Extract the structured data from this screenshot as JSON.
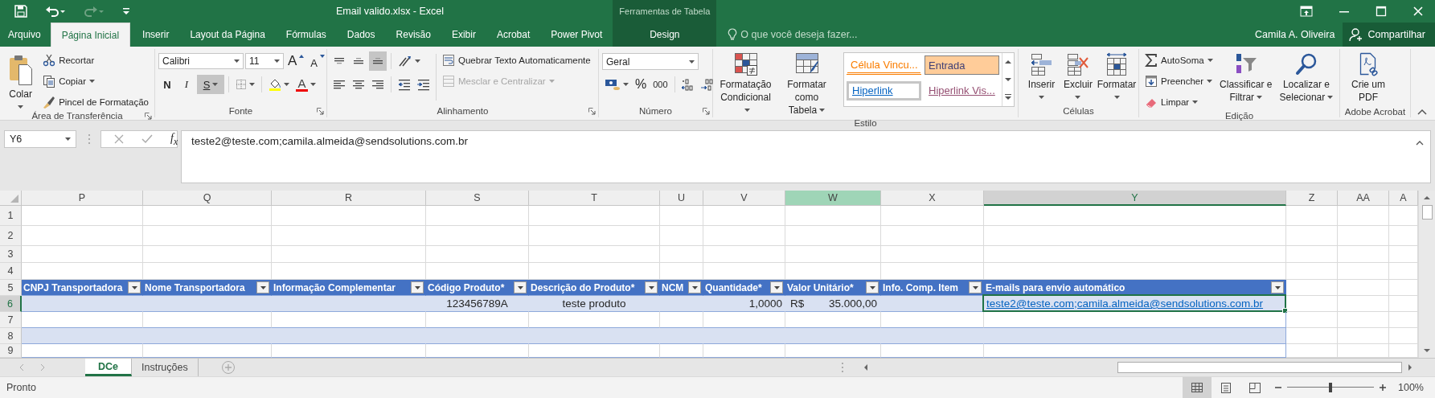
{
  "window": {
    "title": "Email valido.xlsx - Excel"
  },
  "contextual_tab_group": {
    "label": "Ferramentas de Tabela"
  },
  "tabs": [
    {
      "label": "Arquivo",
      "selected": false,
      "kind": "file"
    },
    {
      "label": "Página Inicial",
      "selected": true,
      "kind": "normal"
    },
    {
      "label": "Inserir",
      "selected": false,
      "kind": "normal"
    },
    {
      "label": "Layout da Página",
      "selected": false,
      "kind": "normal"
    },
    {
      "label": "Fórmulas",
      "selected": false,
      "kind": "normal"
    },
    {
      "label": "Dados",
      "selected": false,
      "kind": "normal"
    },
    {
      "label": "Revisão",
      "selected": false,
      "kind": "normal"
    },
    {
      "label": "Exibir",
      "selected": false,
      "kind": "normal"
    },
    {
      "label": "Acrobat",
      "selected": false,
      "kind": "normal"
    },
    {
      "label": "Power Pivot",
      "selected": false,
      "kind": "normal"
    },
    {
      "label": "Design",
      "selected": false,
      "kind": "contextual"
    }
  ],
  "tell_me": {
    "placeholder": "O que você deseja fazer..."
  },
  "account": {
    "user": "Camila A. Oliveira",
    "share": "Compartilhar"
  },
  "ribbon": {
    "groups": [
      {
        "kind": "clipboard",
        "label": "Área de Transferência",
        "launcher": true,
        "buttons": [
          {
            "label": "Colar"
          },
          {
            "label": "Recortar"
          },
          {
            "label": "Copiar"
          },
          {
            "label": "Pincel de Formatação"
          }
        ]
      },
      {
        "kind": "font",
        "label": "Fonte",
        "launcher": true,
        "font_name": "Calibri",
        "font_size": "11",
        "grow": "A",
        "shrink": "A",
        "styles": [
          {
            "label": "N",
            "pressed": false
          },
          {
            "label": "I",
            "pressed": false
          },
          {
            "label": "S",
            "pressed": true
          }
        ],
        "font_color": "A"
      },
      {
        "kind": "alignment",
        "label": "Alinhamento",
        "launcher": true,
        "vertical": [
          {
            "selected": false
          },
          {
            "selected": false
          },
          {
            "selected": true
          }
        ],
        "horizontal": [
          {
            "selected": false
          },
          {
            "selected": false
          },
          {
            "selected": false
          }
        ],
        "wrap_text": {
          "label": "Quebrar Texto Automaticamente",
          "disabled": false
        },
        "merge": {
          "label": "Mesclar e Centralizar",
          "disabled": true
        }
      },
      {
        "kind": "number",
        "label": "Número",
        "launcher": true,
        "format": "Geral",
        "percent": "%",
        "thousands": "000"
      },
      {
        "kind": "styles",
        "label": "Estilo",
        "buttons": [
          {
            "label": "Formatação Condicional"
          },
          {
            "label": "Formatar como Tabela"
          }
        ],
        "gallery": [
          {
            "label": "Célula Vincu...",
            "kind": "linked",
            "selected": false
          },
          {
            "label": "Entrada",
            "kind": "input",
            "selected": false
          },
          {
            "label": "Hiperlink",
            "kind": "hyperlink",
            "selected": true
          },
          {
            "label": "Hiperlink Vis...",
            "kind": "followed",
            "selected": false
          }
        ]
      },
      {
        "kind": "cells",
        "label": "Células",
        "buttons": [
          {
            "label": "Inserir"
          },
          {
            "label": "Excluir"
          },
          {
            "label": "Formatar"
          }
        ]
      },
      {
        "kind": "editing",
        "label": "Edição",
        "buttons": [
          {
            "label": "AutoSoma"
          },
          {
            "label": "Preencher"
          },
          {
            "label": "Limpar"
          },
          {
            "label": "Classificar e Filtrar"
          },
          {
            "label": "Localizar e Selecionar"
          }
        ]
      },
      {
        "kind": "acrobat",
        "label": "Adobe Acrobat",
        "buttons": [
          {
            "label": "Crie um PDF"
          }
        ]
      }
    ]
  },
  "formula_bar": {
    "name_box": "Y6",
    "function_label": "f$_{x}$",
    "value": "teste2@teste.com;camila.almeida@sendsolutions.com.br"
  },
  "sheet": {
    "columns": [
      {
        "label": "P",
        "selected": false,
        "highlighted": false
      },
      {
        "label": "Q",
        "selected": false,
        "highlighted": false
      },
      {
        "label": "R",
        "selected": false,
        "highlighted": false
      },
      {
        "label": "S",
        "selected": false,
        "highlighted": false
      },
      {
        "label": "T",
        "selected": false,
        "highlighted": false
      },
      {
        "label": "U",
        "selected": false,
        "highlighted": false
      },
      {
        "label": "V",
        "selected": false,
        "highlighted": false
      },
      {
        "label": "W",
        "selected": false,
        "highlighted": true
      },
      {
        "label": "X",
        "selected": false,
        "highlighted": false
      },
      {
        "label": "Y",
        "selected": true,
        "highlighted": false
      },
      {
        "label": "Z",
        "selected": false,
        "highlighted": false
      },
      {
        "label": "AA",
        "selected": false,
        "highlighted": false
      },
      {
        "label": "A",
        "selected": false,
        "highlighted": false
      }
    ],
    "rows": [
      {
        "number": "1",
        "selected": false,
        "kind": "blank"
      },
      {
        "number": "2",
        "selected": false,
        "kind": "blank"
      },
      {
        "number": "3",
        "selected": false,
        "kind": "blank"
      },
      {
        "number": "4",
        "selected": false,
        "kind": "blank"
      },
      {
        "number": "5",
        "selected": false,
        "kind": "table-header",
        "cells": [
          {
            "text": "CNPJ Transportadora"
          },
          {
            "text": "Nome Transportadora"
          },
          {
            "text": "Informação Complementar"
          },
          {
            "text": "Código Produto*"
          },
          {
            "text": "Descrição do Produto*"
          },
          {
            "text": "NCM"
          },
          {
            "text": "Quantidade*"
          },
          {
            "text": "Valor Unitário*"
          },
          {
            "text": "Info. Comp. Item"
          },
          {
            "text": "E-mails para envio automático"
          }
        ]
      },
      {
        "number": "6",
        "selected": true,
        "kind": "table-row",
        "cells": [
          {
            "kind": "empty",
            "selected": false
          },
          {
            "kind": "empty",
            "selected": false
          },
          {
            "kind": "empty",
            "selected": false
          },
          {
            "kind": "centered",
            "text": "123456789A",
            "selected": false
          },
          {
            "kind": "centered",
            "text": "teste produto",
            "selected": false
          },
          {
            "kind": "empty",
            "selected": false
          },
          {
            "kind": "number",
            "text": "1,0000",
            "selected": false
          },
          {
            "kind": "accounting",
            "currency": "R$",
            "text": "35.000,00",
            "selected": false
          },
          {
            "kind": "empty",
            "selected": false
          },
          {
            "kind": "link",
            "text": "teste2@teste.com;camila.almeida@sendsolutions.com.br",
            "selected": true
          }
        ]
      },
      {
        "number": "7",
        "selected": false,
        "kind": "table-row"
      },
      {
        "number": "8",
        "selected": false,
        "kind": "table-row"
      },
      {
        "number": "9",
        "selected": false,
        "kind": "table-row"
      }
    ]
  },
  "sheet_tabs": [
    {
      "label": "DCe",
      "selected": true
    },
    {
      "label": "Instruções",
      "selected": false
    }
  ],
  "status_bar": {
    "status": "Pronto",
    "views": [
      {
        "selected": true
      },
      {
        "selected": false
      },
      {
        "selected": false
      }
    ],
    "zoom": {
      "level": 0.5,
      "reading": "100%"
    }
  }
}
